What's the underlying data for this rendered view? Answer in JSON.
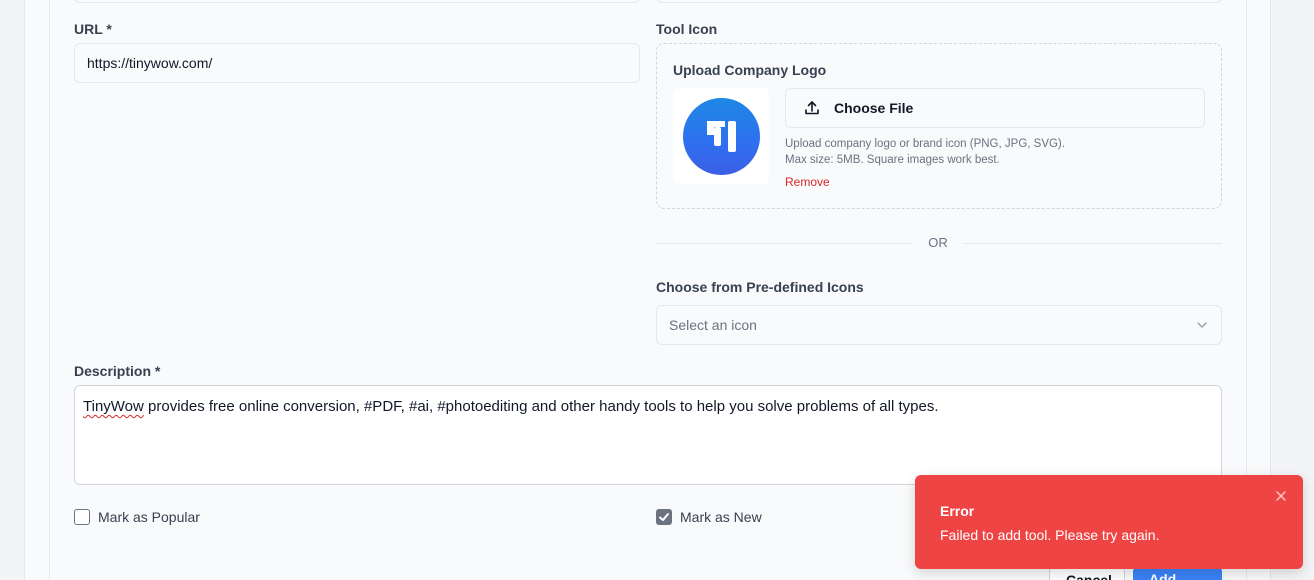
{
  "form": {
    "url_label": "URL *",
    "url_value": "https://tinywow.com/",
    "tool_icon_label": "Tool Icon",
    "upload_label": "Upload Company Logo",
    "choose_file": "Choose File",
    "helper_line1": "Upload company logo or brand icon (PNG, JPG, SVG).",
    "helper_line2": "Max size: 5MB. Square images work best.",
    "remove": "Remove",
    "or": "OR",
    "predefined_label": "Choose from Pre-defined Icons",
    "select_placeholder": "Select an icon",
    "description_label": "Description *",
    "description_first_word": "TinyWow",
    "description_rest": " provides free online conversion, #PDF, #ai, #photoediting and other handy tools to help you solve problems of all types.",
    "popular_label": "Mark as Popular",
    "popular_checked": false,
    "new_label": "Mark as New",
    "new_checked": true,
    "cancel": "Cancel",
    "add_tool": "Add Tool"
  },
  "toast": {
    "title": "Error",
    "message": "Failed to add tool. Please try again.",
    "color": "#ef4444"
  },
  "icons": {
    "upload": "upload-icon",
    "chevron": "chevron-down-icon",
    "check": "check-icon",
    "close": "close-icon",
    "logo": "tinywow-logo"
  }
}
